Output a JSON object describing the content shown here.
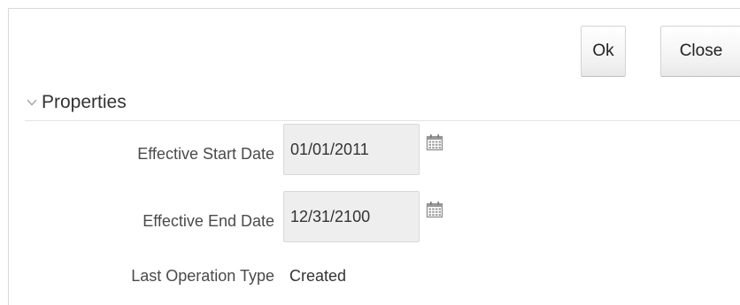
{
  "actions": {
    "ok_label": "Ok",
    "close_label": "Close"
  },
  "section": {
    "title": "Properties",
    "expand_icon": "chevron-down-icon"
  },
  "fields": {
    "start_date": {
      "label": "Effective Start Date",
      "value": "01/01/2011",
      "icon": "calendar-icon"
    },
    "end_date": {
      "label": "Effective End Date",
      "value": "12/31/2100",
      "icon": "calendar-icon"
    },
    "last_operation": {
      "label": "Last Operation Type",
      "value": "Created"
    }
  },
  "colors": {
    "date_field_bg": "#eeeeee",
    "border": "#d9d9d9",
    "icon": "#8a8a8a"
  }
}
